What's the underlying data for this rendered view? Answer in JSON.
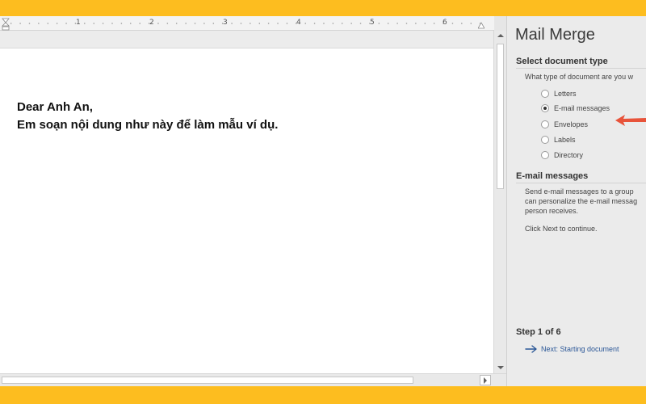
{
  "ruler": {
    "numbers": [
      "1",
      "2",
      "3",
      "4",
      "5",
      "6"
    ]
  },
  "document": {
    "lines": [
      "Dear Anh An,",
      "Em soạn nội dung như này để làm mẫu ví dụ."
    ]
  },
  "mail_merge": {
    "title": "Mail Merge",
    "select_type": {
      "heading": "Select document type",
      "question": "What type of document are you w",
      "options": [
        {
          "label": "Letters",
          "selected": false
        },
        {
          "label": "E-mail messages",
          "selected": true
        },
        {
          "label": "Envelopes",
          "selected": false
        },
        {
          "label": "Labels",
          "selected": false
        },
        {
          "label": "Directory",
          "selected": false
        }
      ]
    },
    "email_section": {
      "heading": "E-mail messages",
      "description": [
        "Send e-mail messages to a group",
        "can personalize the e-mail messag",
        "person receives."
      ],
      "hint": "Click Next to continue."
    },
    "step": {
      "label": "Step 1 of 6",
      "next_link": "Next: Starting document"
    }
  },
  "colors": {
    "frame": "#fdbd1f",
    "annotation_arrow": "#e8533a",
    "link": "#2b5797"
  },
  "icons": {
    "next": "right-arrow-icon",
    "annotation": "red-arrow-icon"
  }
}
